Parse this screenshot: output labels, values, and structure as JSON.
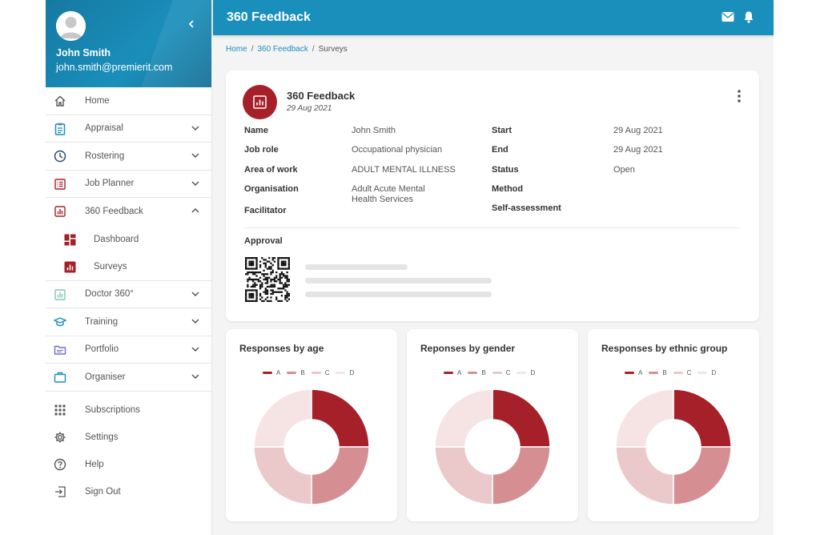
{
  "user": {
    "name": "John Smith",
    "email": "john.smith@premierit.com"
  },
  "nav": {
    "items": [
      {
        "label": "Home",
        "icon": "home-icon",
        "expandable": false
      },
      {
        "label": "Appraisal",
        "icon": "clipboard-icon",
        "expandable": true
      },
      {
        "label": "Rostering",
        "icon": "clock-icon",
        "expandable": true
      },
      {
        "label": "Job Planner",
        "icon": "list-icon",
        "expandable": true
      },
      {
        "label": "360 Feedback",
        "icon": "bar-chart-icon",
        "expandable": true,
        "expanded": true
      },
      {
        "label": "Doctor 360°",
        "icon": "bar-chart-outline-icon",
        "expandable": true
      },
      {
        "label": "Training",
        "icon": "graduation-cap-icon",
        "expandable": true
      },
      {
        "label": "Portfolio",
        "icon": "folder-icon",
        "expandable": true
      },
      {
        "label": "Organiser",
        "icon": "briefcase-icon",
        "expandable": true
      }
    ],
    "subitems": [
      {
        "label": "Dashboard",
        "icon": "dashboard-icon"
      },
      {
        "label": "Surveys",
        "icon": "bar-chart-icon"
      }
    ],
    "bottom": [
      {
        "label": "Subscriptions",
        "icon": "grid-icon"
      },
      {
        "label": "Settings",
        "icon": "gear-icon"
      },
      {
        "label": "Help",
        "icon": "help-icon"
      },
      {
        "label": "Sign Out",
        "icon": "sign-out-icon"
      }
    ]
  },
  "header": {
    "title": "360 Feedback"
  },
  "breadcrumb": {
    "home": "Home",
    "section": "360 Feedback",
    "current": "Surveys",
    "separator": "/"
  },
  "survey": {
    "title": "360 Feedback",
    "date": "29 Aug 2021",
    "labels": {
      "name": "Name",
      "job_role": "Job role",
      "area": "Area of work",
      "organisation": "Organisation",
      "facilitator": "Facilitator",
      "start": "Start",
      "end": "End",
      "status": "Status",
      "method": "Method",
      "self_assessment": "Self-assessment",
      "approval": "Approval"
    },
    "values": {
      "name": "John Smith",
      "job_role": "Occupational physician",
      "area": "ADULT MENTAL ILLNESS",
      "organisation_line1": "Adult Acute Mental",
      "organisation_line2": "Health Services",
      "start": "29 Aug 2021",
      "end": "29 Aug 2021",
      "status": "Open"
    }
  },
  "colors": {
    "A": "#a6202a",
    "B": "#d58f93",
    "C": "#ebc8ca",
    "D": "#f6e4e5",
    "accent": "#1a8fbb"
  },
  "chart_data": [
    {
      "type": "pie",
      "title": "Responses by age",
      "legend": [
        "A",
        "B",
        "C",
        "D"
      ],
      "values": [
        25,
        25,
        25,
        25
      ]
    },
    {
      "type": "pie",
      "title": "Reponses by gender",
      "legend": [
        "A",
        "B",
        "C",
        "D"
      ],
      "values": [
        25,
        25,
        25,
        25
      ]
    },
    {
      "type": "pie",
      "title": "Responses by ethnic group",
      "legend": [
        "A",
        "B",
        "C",
        "D"
      ],
      "values": [
        25,
        25,
        25,
        25
      ]
    }
  ]
}
